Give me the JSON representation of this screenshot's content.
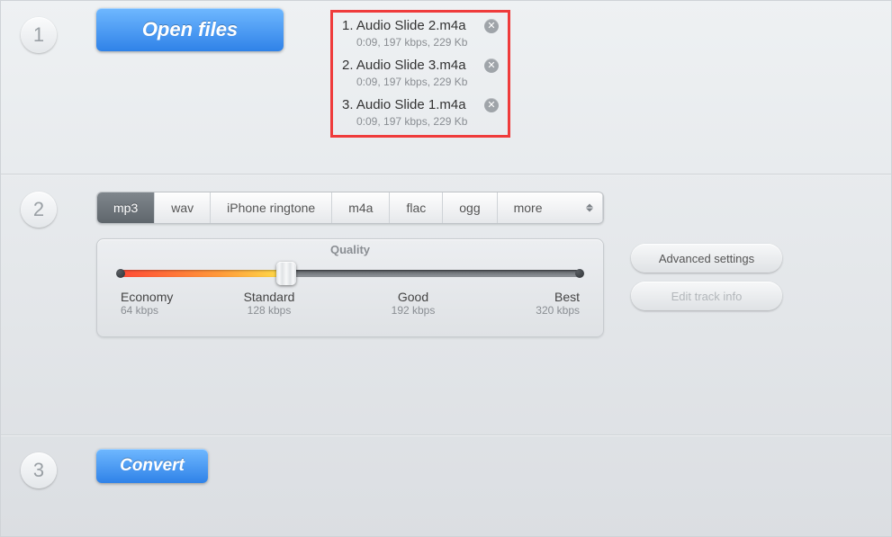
{
  "steps": {
    "s1": "1",
    "s2": "2",
    "s3": "3"
  },
  "buttons": {
    "open_files": "Open files",
    "convert": "Convert",
    "advanced": "Advanced settings",
    "edit_track": "Edit track info"
  },
  "files": [
    {
      "idx": "1.",
      "name": "Audio Slide 2.m4a",
      "meta": "0:09, 197 kbps, 229 Kb"
    },
    {
      "idx": "2.",
      "name": "Audio Slide 3.m4a",
      "meta": "0:09, 197 kbps, 229 Kb"
    },
    {
      "idx": "3.",
      "name": "Audio Slide 1.m4a",
      "meta": "0:09, 197 kbps, 229 Kb"
    }
  ],
  "formats": {
    "active": "mp3",
    "items": [
      "mp3",
      "wav",
      "iPhone ringtone",
      "m4a",
      "flac",
      "ogg",
      "more"
    ]
  },
  "quality": {
    "title": "Quality",
    "marks": [
      {
        "label": "Economy",
        "sub": "64 kbps"
      },
      {
        "label": "Standard",
        "sub": "128 kbps"
      },
      {
        "label": "Good",
        "sub": "192 kbps"
      },
      {
        "label": "Best",
        "sub": "320 kbps"
      }
    ]
  }
}
